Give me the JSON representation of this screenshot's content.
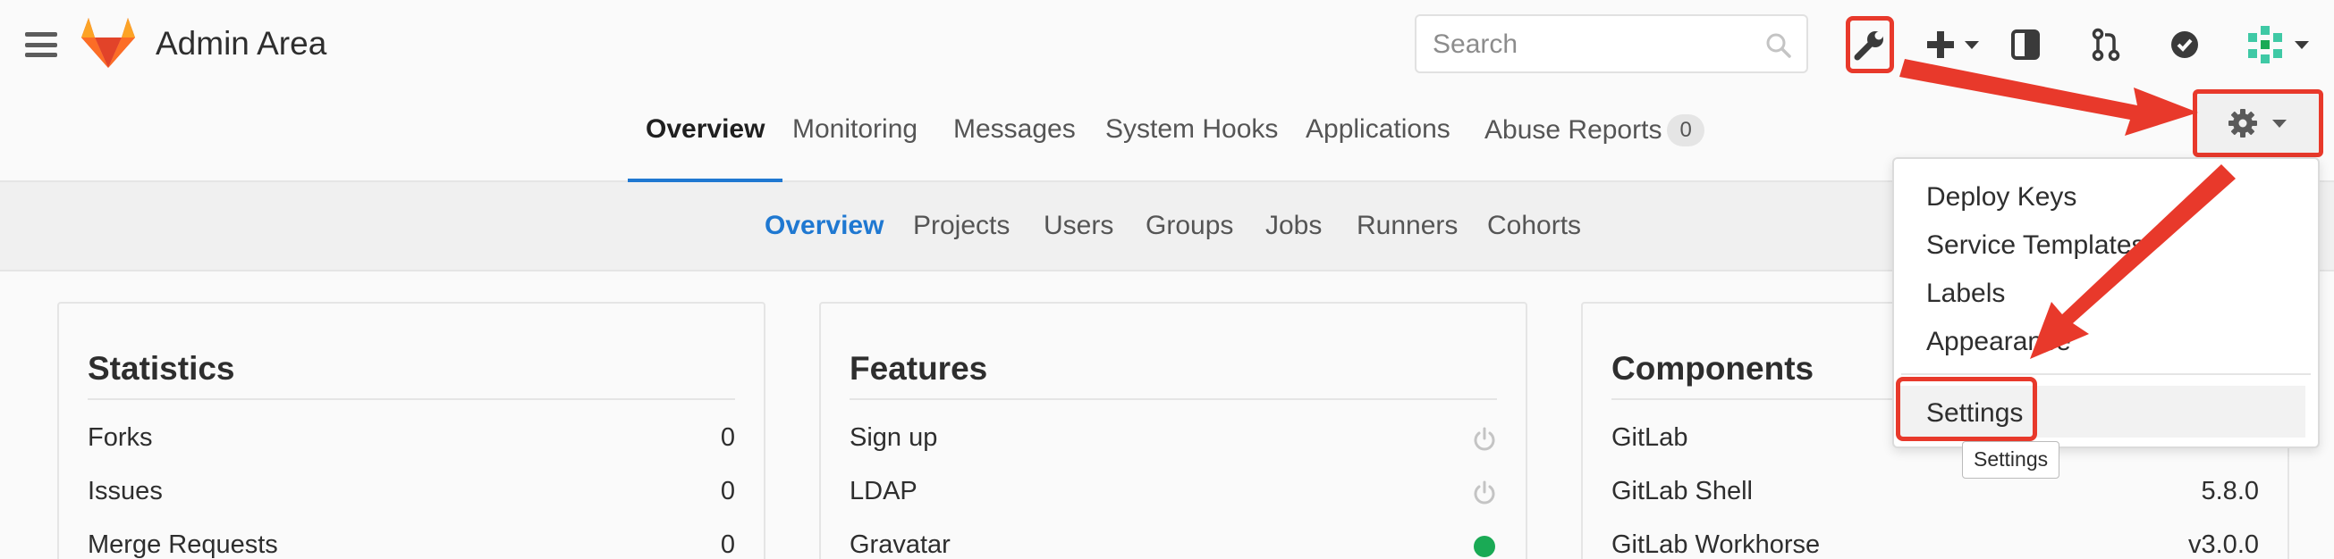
{
  "header": {
    "title": "Admin Area",
    "search_placeholder": "Search",
    "logo": "gitlab-logo",
    "icons": [
      "menu-icon",
      "wrench-icon",
      "plus-icon",
      "sidebar-toggle-icon",
      "merge-request-icon",
      "todo-check-icon",
      "user-avatar"
    ]
  },
  "admin_tabs": [
    {
      "label": "Overview",
      "active": true
    },
    {
      "label": "Monitoring",
      "active": false
    },
    {
      "label": "Messages",
      "active": false
    },
    {
      "label": "System Hooks",
      "active": false
    },
    {
      "label": "Applications",
      "active": false
    },
    {
      "label": "Abuse Reports",
      "active": false,
      "badge": "0"
    }
  ],
  "subnav": [
    {
      "label": "Overview",
      "active": true
    },
    {
      "label": "Projects",
      "active": false
    },
    {
      "label": "Users",
      "active": false
    },
    {
      "label": "Groups",
      "active": false
    },
    {
      "label": "Jobs",
      "active": false
    },
    {
      "label": "Runners",
      "active": false
    },
    {
      "label": "Cohorts",
      "active": false
    }
  ],
  "settings_menu": {
    "items": [
      "Deploy Keys",
      "Service Templates",
      "Labels",
      "Appearance"
    ],
    "settings_label": "Settings",
    "tooltip": "Settings"
  },
  "panels": {
    "statistics": {
      "title": "Statistics",
      "rows": [
        {
          "label": "Forks",
          "value": "0"
        },
        {
          "label": "Issues",
          "value": "0"
        },
        {
          "label": "Merge Requests",
          "value": "0"
        }
      ]
    },
    "features": {
      "title": "Features",
      "rows": [
        {
          "label": "Sign up",
          "status": "off"
        },
        {
          "label": "LDAP",
          "status": "off"
        },
        {
          "label": "Gravatar",
          "status": "on"
        }
      ]
    },
    "components": {
      "title": "Components",
      "rows": [
        {
          "label": "GitLab",
          "value": ""
        },
        {
          "label": "GitLab Shell",
          "value": "5.8.0"
        },
        {
          "label": "GitLab Workhorse",
          "value": "v3.0.0"
        }
      ]
    }
  },
  "colors": {
    "accent_blue": "#1f78d1",
    "annotation_red": "#e8392b",
    "status_green": "#1aaa55"
  }
}
